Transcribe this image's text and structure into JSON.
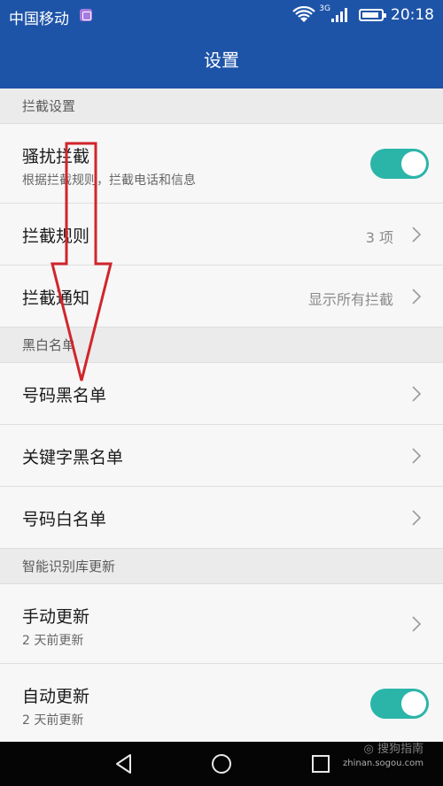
{
  "status_bar": {
    "carrier": "中国移动",
    "network": "3G",
    "time": "20:18"
  },
  "app_bar": {
    "title": "设置"
  },
  "sections": {
    "intercept": {
      "header": "拦截设置",
      "harass": {
        "title": "骚扰拦截",
        "subtitle": "根据拦截规则，拦截电话和信息",
        "toggle_on": true
      },
      "rules": {
        "title": "拦截规则",
        "value": "3 项"
      },
      "notify": {
        "title": "拦截通知",
        "value": "显示所有拦截"
      }
    },
    "lists": {
      "header": "黑白名单",
      "number_blacklist": "号码黑名单",
      "keyword_blacklist": "关键字黑名单",
      "number_whitelist": "号码白名单"
    },
    "update": {
      "header": "智能识别库更新",
      "manual": {
        "title": "手动更新",
        "subtitle": "2 天前更新"
      },
      "auto": {
        "title": "自动更新",
        "subtitle": "2 天前更新",
        "toggle_on": true
      }
    }
  },
  "watermark": {
    "url": "zhinan.sogou.com"
  },
  "colors": {
    "app_bar": "#1e54a8",
    "toggle_on": "#2bb5a9",
    "annotation_arrow": "#d0262b",
    "nav_bar": "#050505"
  }
}
